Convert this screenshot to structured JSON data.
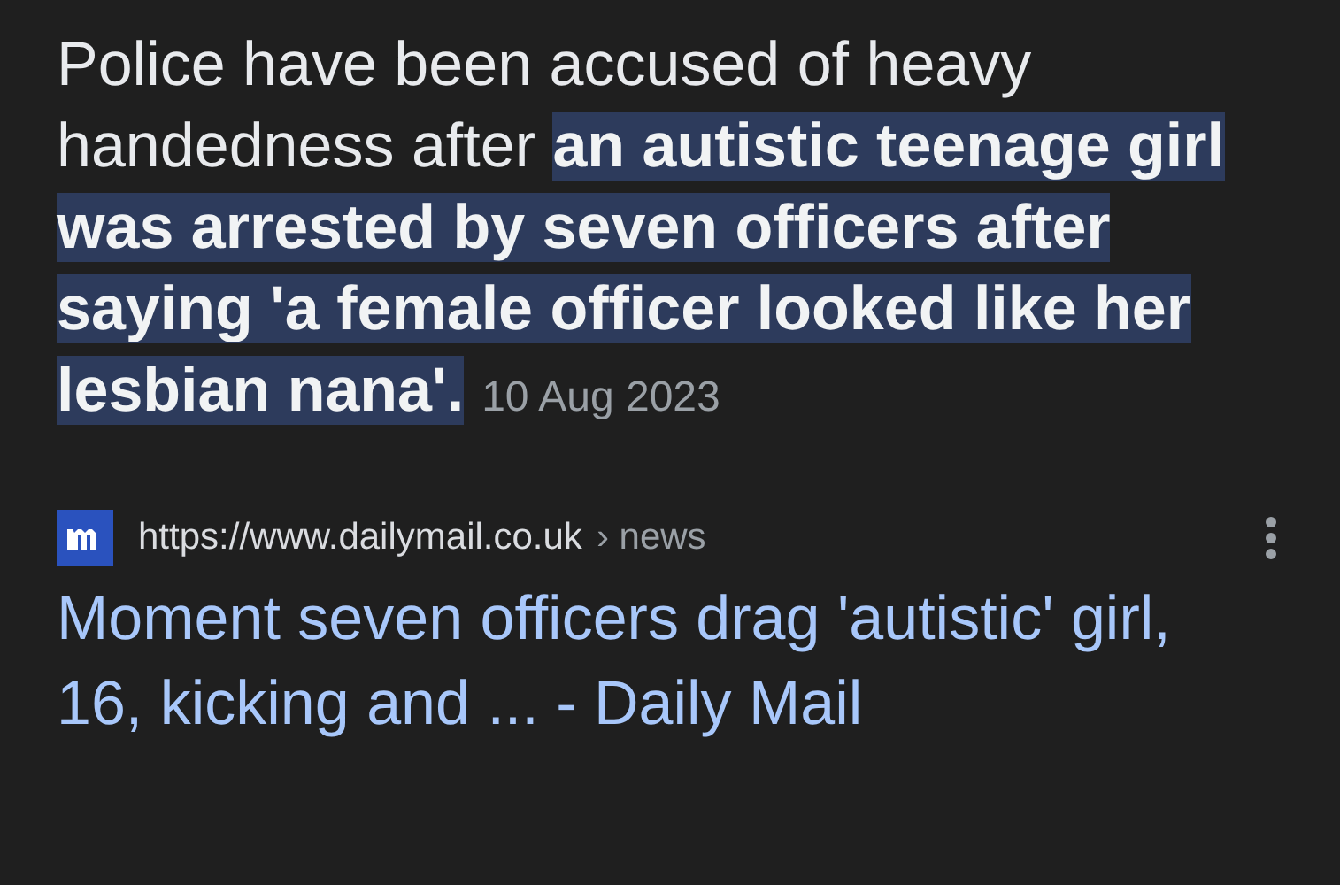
{
  "snippet": {
    "text": "Police have been accused of heavy handedness after **an autistic teenage girl was arrested by seven officers after saying 'a female officer looked like her lesbian nana'.**",
    "date": "10 Aug 2023"
  },
  "result": {
    "url": "https://www.dailymail.co.uk",
    "breadcrumb": "› news",
    "title": "Moment seven officers drag 'autistic' girl, 16, kicking and ... - Daily Mail"
  }
}
